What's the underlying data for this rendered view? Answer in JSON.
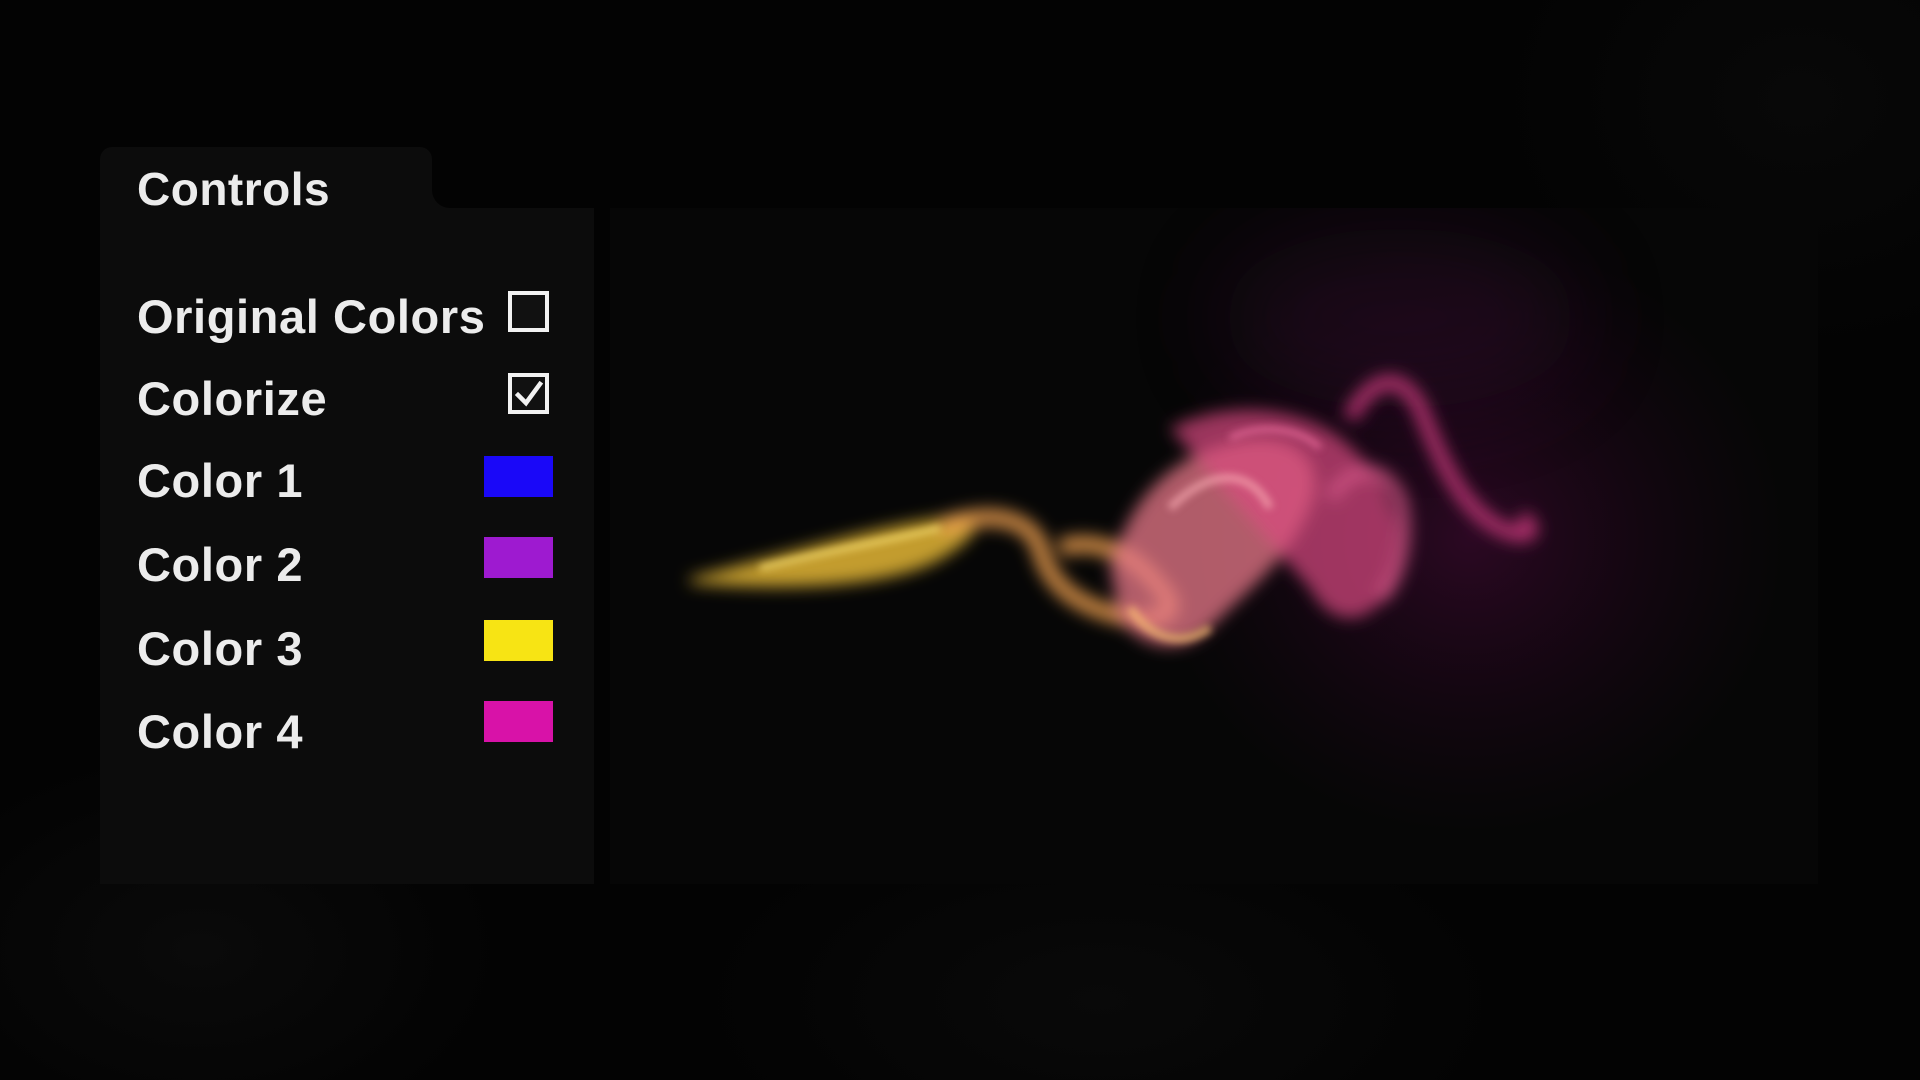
{
  "panel": {
    "title": "Controls",
    "rows": [
      {
        "label": "Original Colors",
        "type": "checkbox",
        "checked": false
      },
      {
        "label": "Colorize",
        "type": "checkbox",
        "checked": true
      },
      {
        "label": "Color 1",
        "type": "color",
        "value": "#1a08f8"
      },
      {
        "label": "Color 2",
        "type": "color",
        "value": "#9e1ad0"
      },
      {
        "label": "Color 3",
        "type": "color",
        "value": "#f7e414"
      },
      {
        "label": "Color 4",
        "type": "color",
        "value": "#d812a8"
      }
    ]
  },
  "viewport": {
    "content": "colorized smoke simulation",
    "smoke_colors": [
      "#f7c23a",
      "#f0a050",
      "#e86a8a",
      "#c83a7a",
      "#7a1a5a"
    ]
  }
}
